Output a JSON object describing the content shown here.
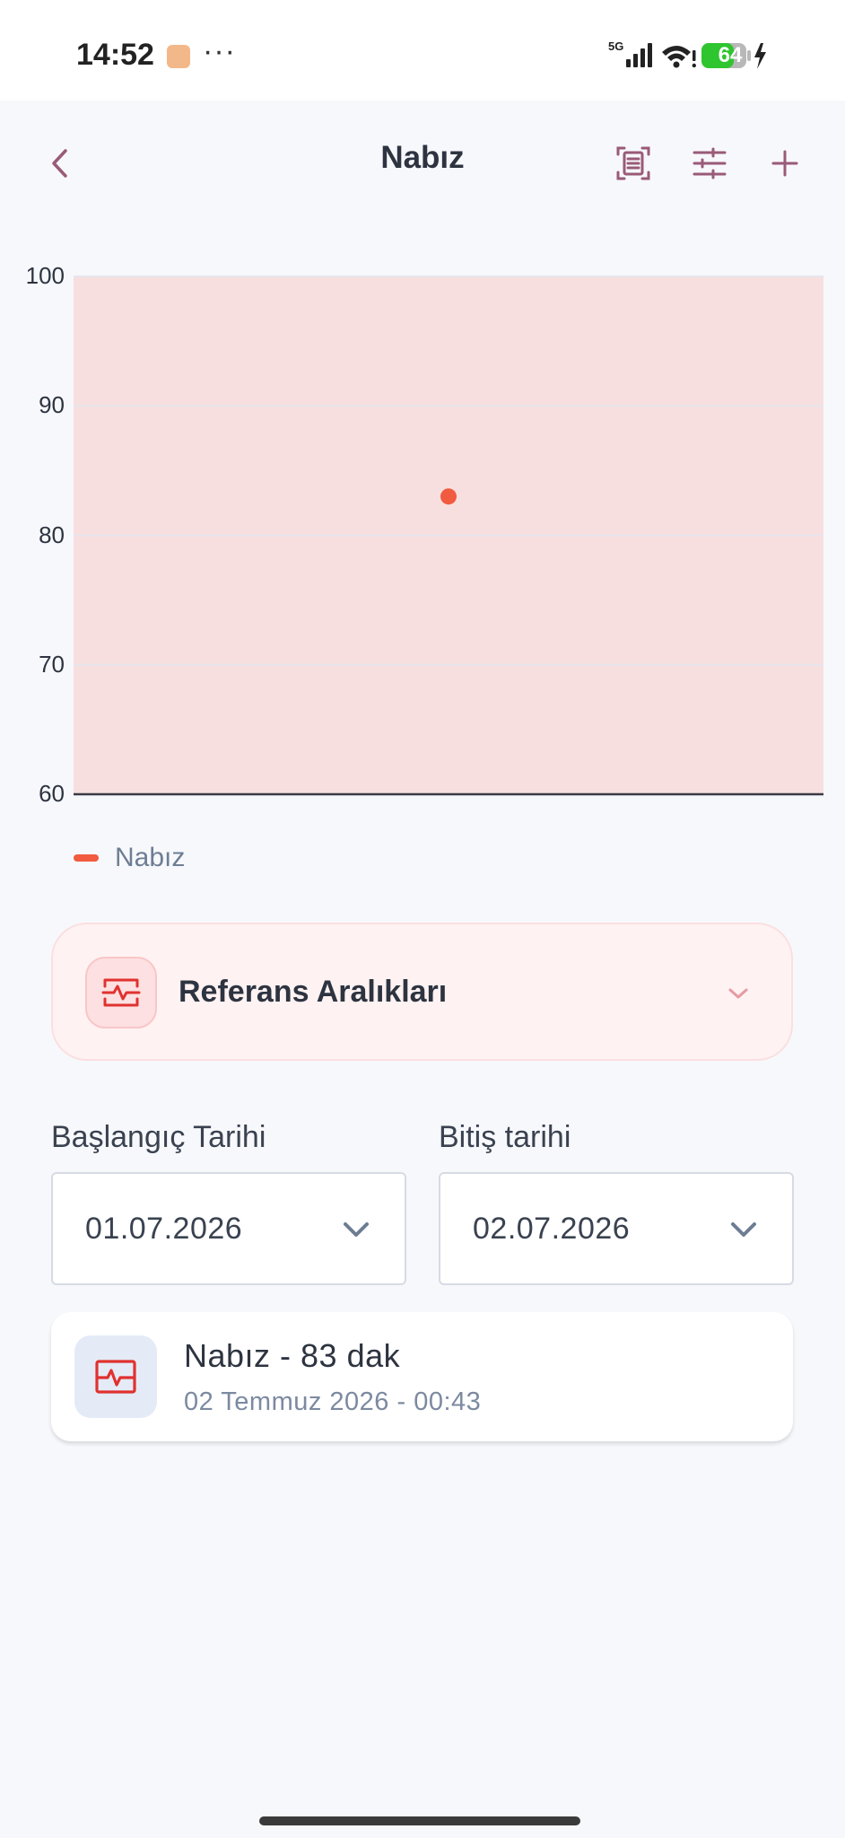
{
  "status_bar": {
    "time": "14:52",
    "dots": "···",
    "network": "5G",
    "battery": "64",
    "icons": [
      "app-notification-icon",
      "signal-icon",
      "wifi-icon",
      "battery-icon",
      "charging-icon"
    ]
  },
  "header": {
    "title": "Nabız",
    "icons": [
      "back-chevron-icon",
      "document-scan-icon",
      "filter-sliders-icon",
      "plus-icon"
    ]
  },
  "chart_data": {
    "type": "scatter",
    "y_ticks": [
      "100",
      "90",
      "80",
      "70",
      "60"
    ],
    "ylim": [
      60,
      100
    ],
    "grid": true,
    "series": [
      {
        "name": "Nabız",
        "color": "#f15b3f",
        "points": [
          {
            "x": "02 Temmuz 2026 - 00:43",
            "y": 83
          }
        ]
      }
    ],
    "reference_band": {
      "from": 60,
      "to": 100,
      "color": "#f8dfdf"
    },
    "legend": "bottom-left"
  },
  "reference": {
    "title": "Referans Aralıkları",
    "icon": "heart-pulse-icon",
    "chevron": "chevron-down-icon"
  },
  "dates": {
    "start_label": "Başlangıç Tarihi",
    "start_value": "01.07.2026",
    "end_label": "Bitiş tarihi",
    "end_value": "02.07.2026"
  },
  "records": [
    {
      "title": "Nabız - 83 dak",
      "subtitle": "02 Temmuz 2026 - 00:43",
      "icon": "heart-pulse-icon"
    }
  ],
  "colors": {
    "accent": "#9a5a78",
    "point": "#f15b3f",
    "band": "#f8dfdf",
    "icon_red": "#e0322f"
  }
}
